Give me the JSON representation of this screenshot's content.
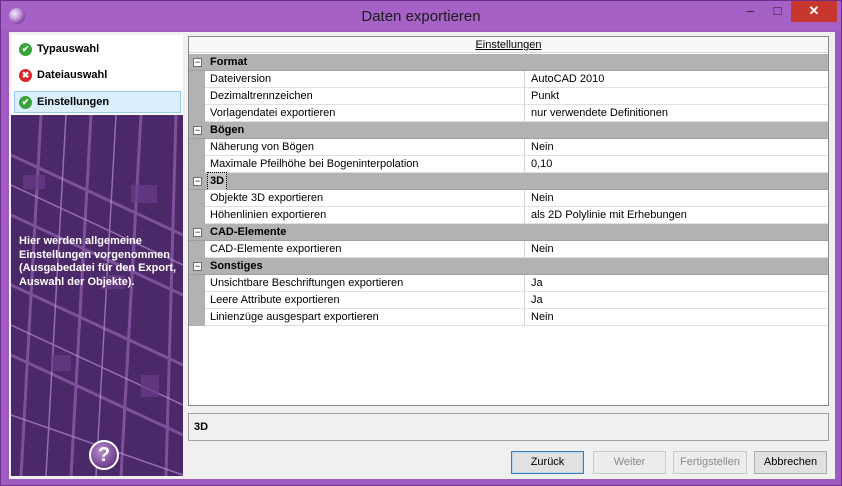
{
  "window": {
    "title": "Daten exportieren"
  },
  "controls": {
    "minimize": "–",
    "maximize": "□",
    "close": "✕"
  },
  "sidebar": {
    "steps": [
      {
        "label": "Typauswahl",
        "status": "ok",
        "icon": "check-icon"
      },
      {
        "label": "Dateiauswahl",
        "status": "error",
        "icon": "error-icon"
      },
      {
        "label": "Einstellungen",
        "status": "ok",
        "icon": "check-icon",
        "active": true
      }
    ],
    "help_text": "Hier werden allgemeine Einstellungen vorgenommen (Ausgabedatei für den Export, Auswahl der Objekte).",
    "help_button": "?"
  },
  "grid": {
    "header": "Einstellungen",
    "categories": [
      {
        "name": "Format",
        "rows": [
          {
            "name": "Dateiversion",
            "value": "AutoCAD 2010"
          },
          {
            "name": "Dezimaltrennzeichen",
            "value": "Punkt"
          },
          {
            "name": "Vorlagendatei exportieren",
            "value": "nur verwendete Definitionen"
          }
        ]
      },
      {
        "name": "Bögen",
        "rows": [
          {
            "name": "Näherung von Bögen",
            "value": "Nein"
          },
          {
            "name": "Maximale Pfeilhöhe bei Bogeninterpolation",
            "value": "0,10"
          }
        ]
      },
      {
        "name": "3D",
        "selected": true,
        "rows": [
          {
            "name": "Objekte 3D exportieren",
            "value": "Nein"
          },
          {
            "name": "Höhenlinien exportieren",
            "value": "als 2D Polylinie mit Erhebungen"
          }
        ]
      },
      {
        "name": "CAD-Elemente",
        "rows": [
          {
            "name": "CAD-Elemente exportieren",
            "value": "Nein"
          }
        ]
      },
      {
        "name": "Sonstiges",
        "rows": [
          {
            "name": "Unsichtbare Beschriftungen exportieren",
            "value": "Ja"
          },
          {
            "name": "Leere Attribute exportieren",
            "value": "Ja"
          },
          {
            "name": "Linienzüge ausgespart exportieren",
            "value": "Nein"
          }
        ]
      }
    ]
  },
  "description": {
    "title": "3D"
  },
  "buttons": {
    "back": "Zurück",
    "next": "Weiter",
    "finish": "Fertigstellen",
    "cancel": "Abbrechen"
  },
  "colors": {
    "accent": "#a661c6",
    "close": "#c7372f",
    "category": "#b2b2b2"
  }
}
